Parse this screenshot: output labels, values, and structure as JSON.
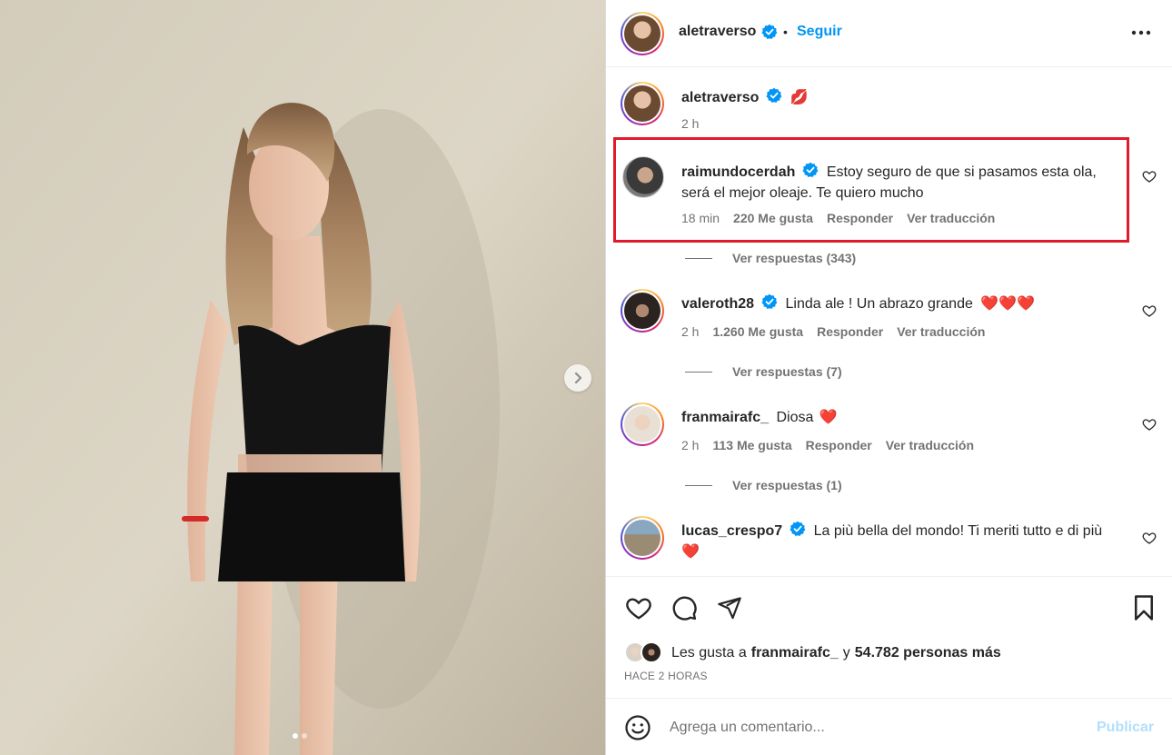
{
  "post": {
    "author": "aletraverso",
    "follow_label": "Seguir",
    "separator": "•",
    "caption_emoji": "💋",
    "caption_time": "2 h"
  },
  "comments": [
    {
      "user": "raimundocerdah",
      "verified": true,
      "text": "Estoy seguro de que si pasamos esta ola, será el mejor oleaje. Te quiero mucho",
      "time": "18 min",
      "likes": "220 Me gusta",
      "reply": "Responder",
      "translate": "Ver traducción",
      "replies": "Ver respuestas (343)"
    },
    {
      "user": "valeroth28",
      "verified": true,
      "text": "Linda ale ! Un abrazo grande",
      "hearts": "❤️❤️❤️",
      "time": "2 h",
      "likes": "1.260 Me gusta",
      "reply": "Responder",
      "translate": "Ver traducción",
      "replies": "Ver respuestas (7)"
    },
    {
      "user": "franmairafc_",
      "verified": false,
      "text": "Diosa",
      "hearts": "❤️",
      "time": "2 h",
      "likes": "113 Me gusta",
      "reply": "Responder",
      "translate": "Ver traducción",
      "replies": "Ver respuestas (1)"
    },
    {
      "user": "lucas_crespo7",
      "verified": true,
      "text": "La più bella del mondo! Ti meriti tutto e di più",
      "hearts": "❤️"
    }
  ],
  "likes_summary": {
    "prefix": "Les gusta a",
    "user": "franmairafc_",
    "connector": "y",
    "count": "54.782 personas más"
  },
  "time_ago": "HACE 2 HORAS",
  "composer": {
    "placeholder": "Agrega un comentario...",
    "publish": "Publicar"
  },
  "icons": {
    "like": "heart-icon",
    "comment": "comment-icon",
    "share": "send-icon",
    "save": "bookmark-icon",
    "emoji": "emoji-icon",
    "more": "more-options-icon",
    "verified": "verified-badge-icon"
  },
  "colors": {
    "link": "#0095f6",
    "publish_disabled": "#b2dffc",
    "highlight": "#e0192b",
    "heart_red": "#e0192b"
  },
  "carousel": {
    "slides": 2,
    "current": 1
  }
}
